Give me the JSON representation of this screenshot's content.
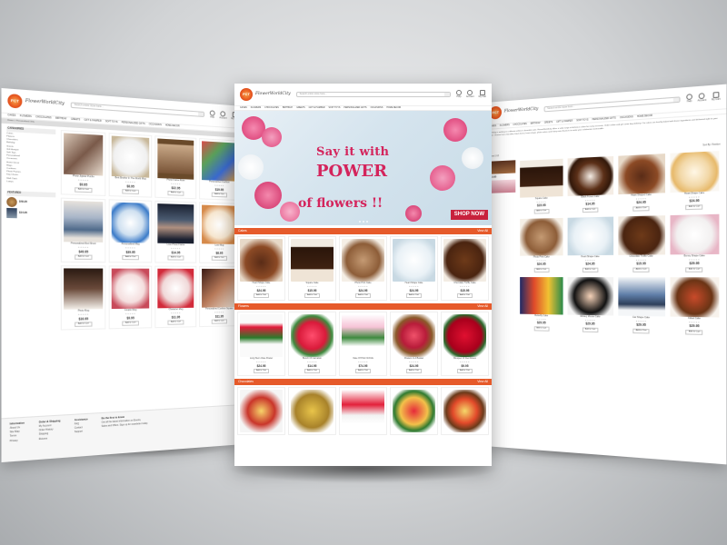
{
  "colors": {
    "accent": "#e65a2a",
    "banner_text": "#d4245c",
    "shop_now": "#c8213c"
  },
  "header": {
    "logo_mark": "FCT",
    "logo_text": "FlowerWorldCity",
    "search_placeholder": "Search entire store here...",
    "icons": [
      {
        "name": "help-icon",
        "label": "Help"
      },
      {
        "name": "account-icon",
        "label": "Account"
      },
      {
        "name": "cart-icon",
        "label": "My Cart"
      }
    ]
  },
  "nav": [
    "CAKES",
    "FLOWERS",
    "CHOCOLATES",
    "BIRTHDAY",
    "GREETS",
    "GIFT & HAMPER",
    "SOFT TOYS",
    "PERSONALIZED GIFTS",
    "OCCASIONS",
    "HOME DECOR"
  ],
  "banner": {
    "line1": "Say it with",
    "line2": "POWER",
    "line3": "of flowers !!",
    "cta": "SHOP NOW"
  },
  "sections": [
    {
      "title": "Cakes",
      "view_all": "View All",
      "products": [
        {
          "name": "Heart Shape Cake",
          "price": "$24.95",
          "img": "cake-heart"
        },
        {
          "name": "Square Cake",
          "price": "$15.95",
          "img": "cake-square"
        },
        {
          "name": "Photo Print Cake",
          "price": "$24.95",
          "img": "cake-photo"
        },
        {
          "name": "Heart Shape Cake",
          "price": "$24.95",
          "img": "cake-white"
        },
        {
          "name": "Chocolate Truffle Cake",
          "price": "$15.95",
          "img": "cake-truffle"
        }
      ]
    },
    {
      "title": "Flowers",
      "view_all": "View All",
      "products": [
        {
          "name": "Long Stem Vase Flower",
          "price": "$24.95",
          "img": "flower-vase"
        },
        {
          "name": "Bunch Of Carnation",
          "price": "$14.95",
          "img": "flower-carnation"
        },
        {
          "name": "Vase Of Pink Orchids",
          "price": "$74.95",
          "img": "flower-orchid"
        },
        {
          "name": "Flowers In A Basket",
          "price": "$24.95",
          "img": "flower-basket"
        },
        {
          "name": "Bouquet Of Red Roses",
          "price": "$9.95",
          "img": "flower-roses"
        }
      ]
    },
    {
      "title": "Chocolates",
      "view_all": "View All",
      "products": [
        {
          "img": "choc-basket"
        },
        {
          "img": "choc-ferrero"
        },
        {
          "img": "choc-mom"
        },
        {
          "img": "choc-bouquet"
        },
        {
          "img": "choc-cake"
        }
      ]
    }
  ],
  "add_to_cart": "Add to Cart",
  "stars": "★★★★★",
  "left_page": {
    "breadcrumb": "Home > Personalized Gifts",
    "sidebar_title": "CATEGORIES",
    "sidebar_items": [
      "Cakes",
      "Flowers",
      "Chocolates",
      "Birthday",
      "Greets",
      "Gift Hamper",
      "Soft Toys",
      "Personalized",
      "Occasions",
      "Home Decor",
      "Mugs",
      "Cushions",
      "Photo Frames",
      "Key Chains",
      "Wall Clock",
      "Lamps"
    ],
    "featured_title": "FEATURED",
    "products": [
      {
        "name": "Photo Jigsaw Puzzle",
        "price": "$9.95",
        "img": "puzzle"
      },
      {
        "name": "Best Brother In The World Mug",
        "price": "$8.95",
        "img": "mug-white"
      },
      {
        "name": "Photo Frame Rose",
        "price": "$22.95",
        "img": "frame"
      },
      {
        "name": "Personalized Cushion",
        "price": "$19.95",
        "img": "cushion"
      },
      {
        "name": "Personalized Bed Sheet",
        "price": "$49.95",
        "img": "bedsheet"
      },
      {
        "name": "Personalized Mug",
        "price": "$39.95",
        "img": "mug-blue"
      },
      {
        "name": "Love Photo Frame",
        "price": "$14.95",
        "img": "frame-dark"
      },
      {
        "name": "Love Mug",
        "price": "$8.95",
        "img": "mug-love"
      },
      {
        "name": "Photo Mug",
        "price": "$16.95",
        "img": "mug-photo"
      },
      {
        "name": "Couple Mug",
        "price": "$9.95",
        "img": "mug-couple"
      },
      {
        "name": "Character Mug",
        "price": "$11.95",
        "img": "mug-char"
      },
      {
        "name": "Personalized Cushion Square",
        "price": "$11.95",
        "img": "cushion-2"
      }
    ],
    "footer": [
      {
        "title": "Information",
        "items": [
          "About Us",
          "Site Map",
          "Terms",
          "Privacy"
        ]
      },
      {
        "title": "Order & Shipping",
        "items": [
          "My Account",
          "Order History",
          "Shipping",
          "Returns"
        ]
      },
      {
        "title": "Assistance",
        "items": [
          "FAQ",
          "Contact",
          "Support"
        ]
      },
      {
        "title": "Be the first to know",
        "items": [
          "Get all the latest information on Events,",
          "Sales and Offers. Sign up for newsletter today."
        ]
      }
    ]
  },
  "right_page": {
    "intro": "Birthday is nothing to celebrate without a beautiful cake. FlowerWorldCity offers a wide range of delicious cakes for every occasion. Order online and get same day delivery. Our cakes are freshly baked with finest ingredients and delivered right to your door. Choose from chocolate, black forest, heart shape, photo cakes and many more flavours to make your celebration memorable.",
    "toolbar_left": "Items 1-16",
    "toolbar_right": "Sort By: Position",
    "products": [
      {
        "name": "Square Cake",
        "price": "$15.95",
        "img": "cake-square"
      },
      {
        "name": "Black Forest Cake",
        "price": "$14.95",
        "img": "cake-forest"
      },
      {
        "name": "Heart Shaped Cake",
        "price": "$24.95",
        "img": "cake-heart"
      },
      {
        "name": "Heart Shape Cake",
        "price": "$24.95",
        "img": "cake-pineapple"
      },
      {
        "name": "Photo Print Cake",
        "price": "$24.95",
        "img": "cake-photo"
      },
      {
        "name": "Heart Shape Cake",
        "price": "$24.95",
        "img": "cake-white"
      },
      {
        "name": "Chocolate Truffle Cake",
        "price": "$15.95",
        "img": "cake-truffle"
      },
      {
        "name": "Bunny Shape Cake",
        "price": "$29.95",
        "img": "cake-bunny"
      },
      {
        "name": "Butterfly Cake",
        "price": "$29.95",
        "img": "cake-butterfly"
      },
      {
        "name": "Mickey Mouse Cake",
        "price": "$29.95",
        "img": "cake-mickey"
      },
      {
        "name": "Car Shape Cake",
        "price": "$29.95",
        "img": "cake-car"
      },
      {
        "name": "Kitkat Cake",
        "price": "$29.95",
        "img": "cake-kitkat"
      }
    ]
  }
}
